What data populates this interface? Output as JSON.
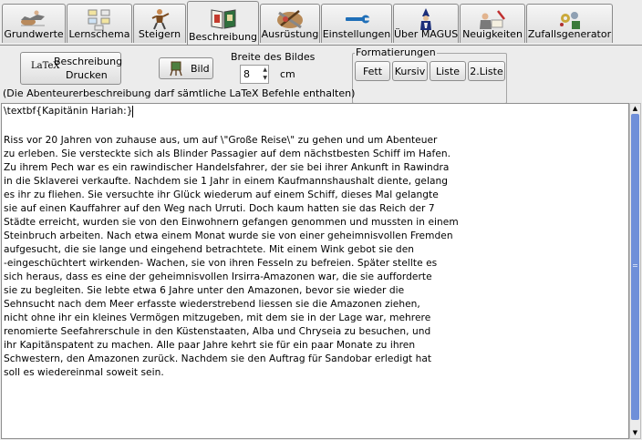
{
  "tabs": [
    {
      "label": "Grundwerte"
    },
    {
      "label": "Lernschema"
    },
    {
      "label": "Steigern"
    },
    {
      "label": "Beschreibung"
    },
    {
      "label": "Ausrüstung"
    },
    {
      "label": "Einstellungen"
    },
    {
      "label": "Über MAGUS"
    },
    {
      "label": "Neuigkeiten"
    },
    {
      "label": "Zufallsgenerator"
    }
  ],
  "active_tab": "Beschreibung",
  "toolbar": {
    "latex_logo": "LaTeX",
    "print_line1": "Beschreibung",
    "print_line2": "Drucken",
    "image_button": "Bild",
    "image_width_label": "Breite des Bildes",
    "image_width_value": "8",
    "image_width_unit": "cm",
    "hint": "(Die Abenteurerbeschreibung darf sämtliche LaTeX Befehle enthalten)"
  },
  "formatting": {
    "title": "Formatierungen",
    "buttons": [
      "Fett",
      "Kursiv",
      "Liste",
      "2.Liste"
    ]
  },
  "editor": {
    "lines": [
      "\\textbf{Kapitänin Hariah:}",
      "",
      "Riss vor 20 Jahren von zuhause aus, um auf \\\"Große Reise\\\" zu gehen und um Abenteuer",
      "zu erleben. Sie versteckte sich als Blinder Passagier auf dem nächstbesten Schiff im Hafen.",
      "Zu ihrem Pech war es ein rawindischer Handelsfahrer, der sie bei ihrer Ankunft in Rawindra",
      "in die Sklaverei verkaufte. Nachdem sie 1 Jahr in einem Kaufmannshaushalt diente, gelang",
      "es ihr zu fliehen. Sie versuchte ihr Glück wiederum auf einem Schiff, dieses Mal gelangte",
      "sie auf einen Kauffahrer auf den Weg nach Urruti. Doch kaum hatten sie das Reich der 7",
      "Städte erreicht, wurden sie von den Einwohnern gefangen genommen und mussten in einem",
      "Steinbruch arbeiten. Nach etwa einem Monat wurde sie von einer geheimnisvollen Fremden",
      "aufgesucht, die sie lange und eingehend betrachtete. Mit einem Wink gebot sie den",
      "-eingeschüchtert wirkenden- Wachen, sie von ihren Fesseln zu befreien. Später stellte es",
      "sich heraus, dass es eine der geheimnisvollen Irsirra-Amazonen war, die sie aufforderte",
      "sie zu begleiten. Sie lebte etwa 6 Jahre unter den Amazonen, bevor sie wieder die",
      "Sehnsucht nach dem Meer erfasste wiederstrebend liessen sie die Amazonen ziehen,",
      "nicht ohne ihr ein kleines Vermögen mitzugeben, mit dem sie in der Lage war, mehrere",
      "renomierte Seefahrerschule in den Küstenstaaten, Alba und Chryseia zu besuchen, und",
      "ihr Kapitänspatent zu machen. Alle paar Jahre kehrt sie für ein paar Monate zu ihren",
      "Schwestern, den Amazonen zurück. Nachdem sie den Auftrag für Sandobar erledigt hat",
      "soll es wiedereinmal soweit sein."
    ]
  },
  "icons": [
    "rider-icon",
    "schema-icon",
    "climber-icon",
    "book-icon",
    "equipment-icon",
    "wrench-icon",
    "wizard-icon",
    "writing-icon",
    "dice-gears-icon",
    "easel-icon",
    "spin-up-icon",
    "spin-down-icon",
    "scroll-up-icon",
    "scroll-down-icon"
  ],
  "colors": {
    "scrollbar_thumb": "#6f8fd9",
    "window_bg": "#ececec"
  }
}
